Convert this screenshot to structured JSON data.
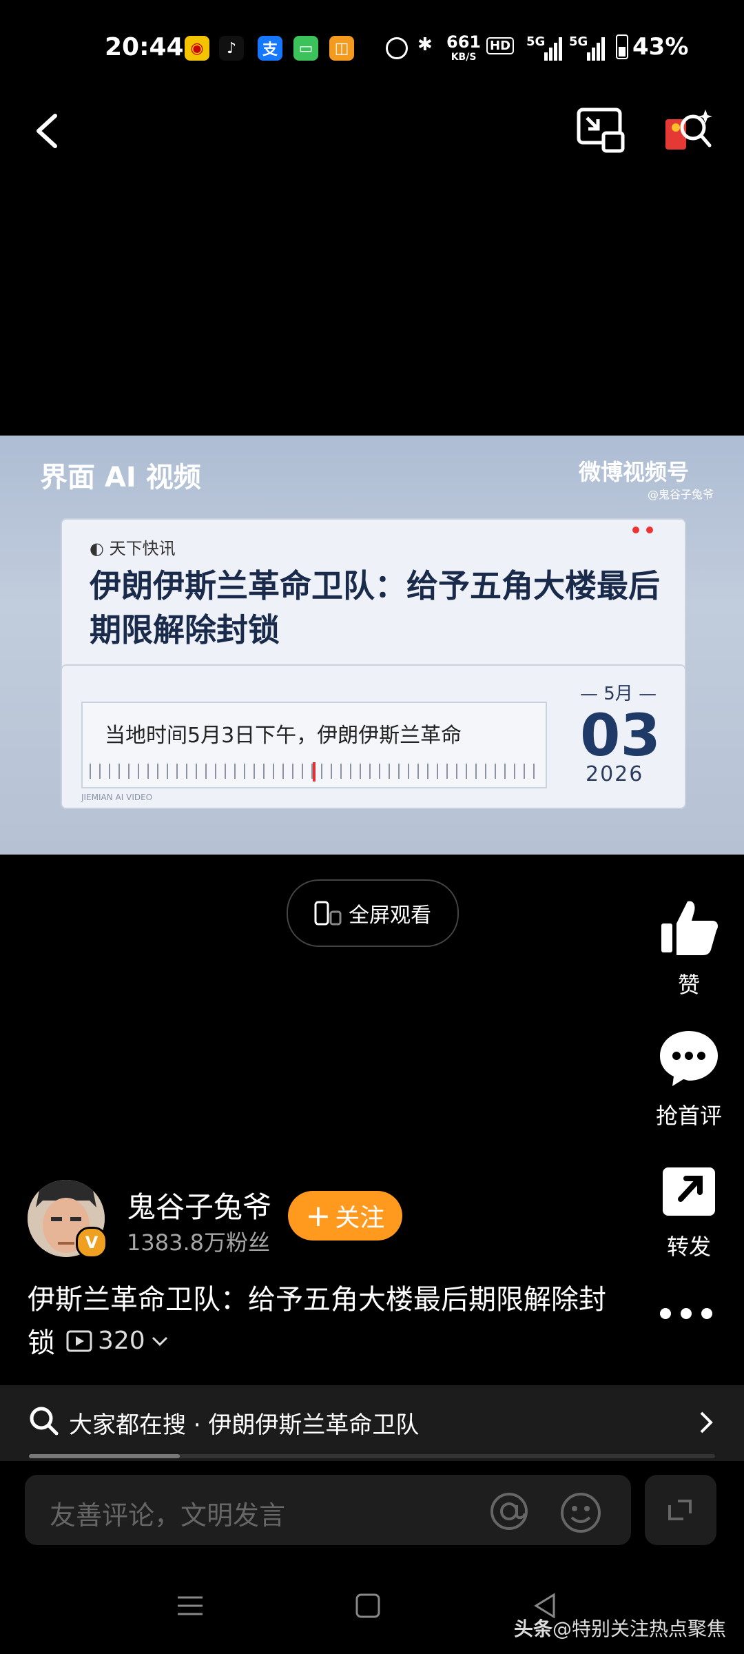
{
  "status_bar": {
    "time": "20:44",
    "network_speed": "661",
    "network_speed_unit": "KB/S",
    "hd_label": "HD",
    "signal_1": "5G",
    "signal_2": "5G",
    "battery": "43%"
  },
  "video": {
    "source_left": "界面 AI 视频",
    "source_right": "微博视频号",
    "source_right_sub": "@鬼谷子兔爷",
    "tag": "天下快讯",
    "headline": "伊朗伊斯兰革命卫队：给予五角大楼最后期限解除封锁",
    "ticker": "当地时间5月3日下午，伊朗伊斯兰革命",
    "date_month": "— 5月 —",
    "date_day": "03",
    "date_year": "2026",
    "footer": "JIEMIAN AI VIDEO"
  },
  "fullscreen_label": "全屏观看",
  "actions": {
    "like": "赞",
    "comment": "抢首评",
    "share": "转发"
  },
  "author": {
    "name": "鬼谷子兔爷",
    "fans": "1383.8万粉丝",
    "follow": "关注",
    "follow_icon": "+"
  },
  "caption": {
    "text": "伊斯兰革命卫队：给予五角大楼最后期限解除封锁",
    "views": "320"
  },
  "search_hint": "大家都在搜 · 伊朗伊斯兰革命卫队",
  "search_progress": 0.22,
  "comment_placeholder": "友善评论，文明发言",
  "watermark": {
    "brand": "头条",
    "handle": "@特别关注热点聚焦"
  },
  "colors": {
    "accent": "#ff9a1f",
    "background": "#000000"
  }
}
